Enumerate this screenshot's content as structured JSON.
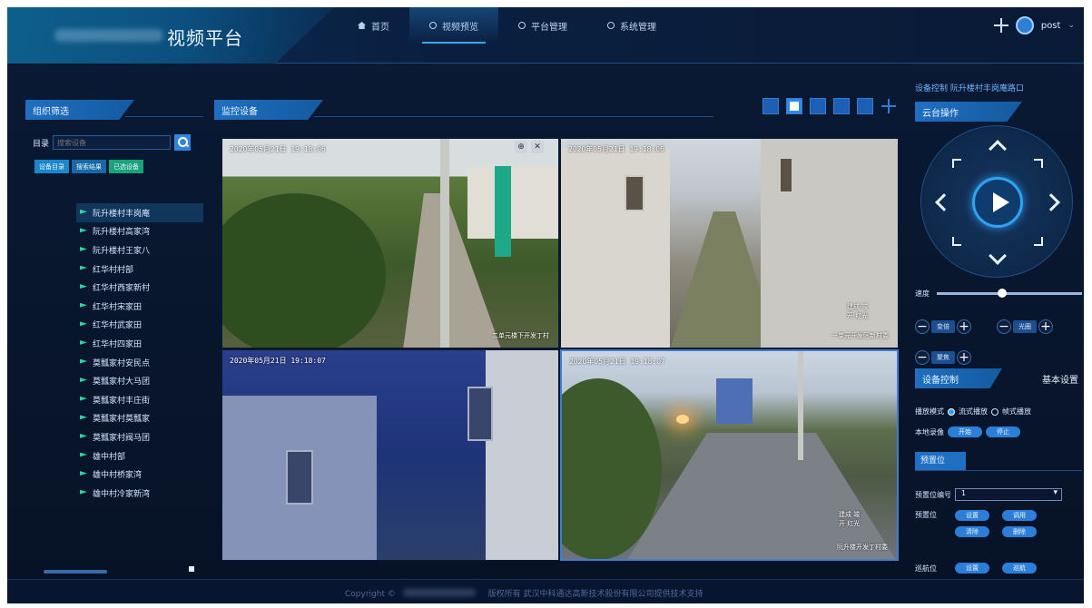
{
  "header": {
    "title": "视频平台",
    "nav": [
      {
        "label": "首页",
        "icon": "home-icon"
      },
      {
        "label": "视频预览",
        "icon": "circle-icon",
        "active": true
      },
      {
        "label": "平台管理",
        "icon": "circle-icon"
      },
      {
        "label": "系统管理",
        "icon": "circle-icon"
      }
    ],
    "user": "post"
  },
  "left_panel": {
    "title": "组织筛选",
    "search_label": "目录",
    "search_placeholder": "搜索设备",
    "filter_buttons": [
      "设备目录",
      "搜索结果",
      "已选设备"
    ],
    "tree_items": [
      "阮升楼村丰岗庵",
      "阮升楼村高家湾",
      "阮升楼村王家八",
      "红华村村部",
      "红华村西家新村",
      "红华村宋家田",
      "红华村武家田",
      "红华村四家田",
      "莫瓢家村安民点",
      "莫瓢家村大马团",
      "莫瓢家村丰庄街",
      "莫瓢家村莫瓢家",
      "莫瓢家村阀马团",
      "雄中村部",
      "雄中村桥家湾",
      "雄中村冷家新湾"
    ],
    "selected_index": 0
  },
  "center_panel": {
    "title": "监控设备",
    "layout_buttons": [
      "layout-1-icon",
      "layout-4-icon",
      "layout-6-icon",
      "layout-9-icon",
      "layout-16-icon",
      "fullscreen-icon"
    ],
    "active_layout": 1,
    "videos": [
      {
        "timestamp": "2020年05月21日  19:18:06",
        "camera": "二单元楼下开发丁村",
        "overlay": ""
      },
      {
        "timestamp": "2020年05月21日  19:18:06",
        "camera": "一单元开发区新村委",
        "overlay": "建成 竣开 红光"
      },
      {
        "timestamp": "2020年05月21日  19:18:07",
        "camera": "",
        "overlay": ""
      },
      {
        "timestamp": "2020年05月21日  19:18:07",
        "camera": "阮升楼开发丁村委",
        "overlay": "建成 竣开 红光"
      }
    ],
    "cell_tools": [
      "zoom-icon",
      "close-icon"
    ]
  },
  "right_panel": {
    "top_link": "设备控制 阮升楼村丰岗庵路口",
    "ptz_title": "云台操作",
    "speed_label": "速度",
    "speed_value": 0.45,
    "steppers": [
      "变倍",
      "光圈",
      "聚焦"
    ],
    "device_tab": "设备控制",
    "basic_tab": "基本设置",
    "mode_label": "播放模式",
    "mode_options": [
      "流式播放",
      "帧式播放"
    ],
    "mode_selected": 0,
    "record_label": "本地录像",
    "record_buttons": [
      "开始",
      "停止"
    ],
    "preset_tab": "预置位",
    "preset_no_label": "预置位编号",
    "preset_no_value": "1",
    "preset_label": "预置位",
    "preset_buttons": [
      "设置",
      "调用",
      "清除",
      "删除"
    ],
    "cruise_label": "巡航位",
    "cruise_buttons": [
      "设置",
      "巡航"
    ]
  },
  "footer": {
    "copyright": "Copyright ©",
    "rights": "版权所有 武汉中科通达高新技术股份有限公司提供技术支持"
  }
}
